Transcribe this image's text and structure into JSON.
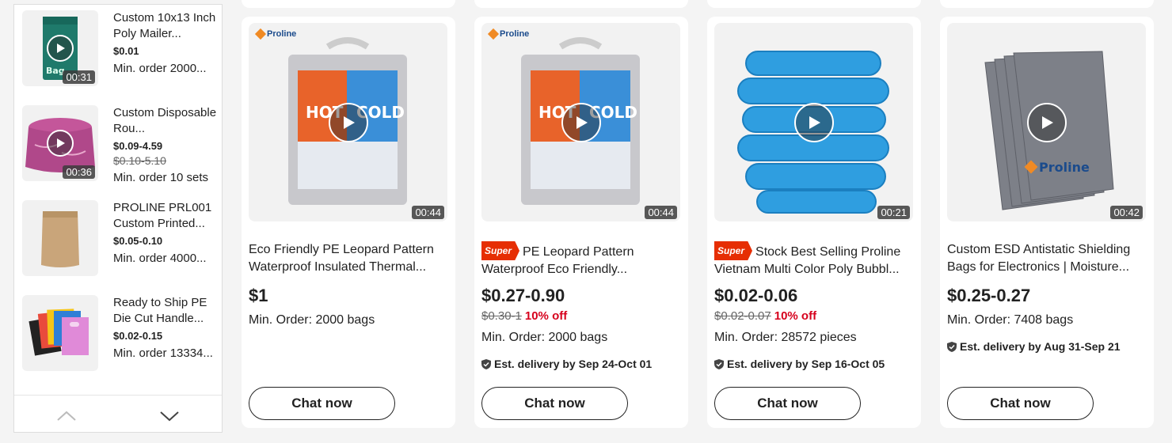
{
  "sidebar": {
    "items": [
      {
        "title": "Custom 10x13 Inch Poly Mailer...",
        "price": "$0.01",
        "old_price": "",
        "moq": "Min. order 2000...",
        "duration": "00:31",
        "thumb_icon": "poly-mailer-bag",
        "thumb_color": "#1f7a6b"
      },
      {
        "title": "Custom Disposable Rou...",
        "price": "$0.09-4.59",
        "old_price": "$0.10-5.10",
        "moq": "Min. order 10 sets",
        "duration": "00:36",
        "thumb_icon": "tablecloth",
        "thumb_color": "#b0488a"
      },
      {
        "title": "PROLINE PRL001 Custom Printed...",
        "price": "$0.05-0.10",
        "old_price": "",
        "moq": "Min. order 4000...",
        "duration": "",
        "thumb_icon": "kraft-pouch",
        "thumb_color": "#c9a57a"
      },
      {
        "title": "Ready to Ship PE Die Cut Handle...",
        "price": "$0.02-0.15",
        "old_price": "",
        "moq": "Min. order 13334...",
        "duration": "",
        "thumb_icon": "colorful-bags",
        "thumb_color": "#2f7fd6"
      }
    ],
    "nav_up_icon": "chevron-up-icon",
    "nav_down_icon": "chevron-down-icon"
  },
  "logo_text": "Proline",
  "products": [
    {
      "super": "",
      "title": "Eco Friendly PE Leopard Pattern Waterproof Insulated Thermal...",
      "price": "$1",
      "old_price": "",
      "discount": "",
      "moq": "Min. Order: 2000 bags",
      "delivery": "",
      "duration": "00:44",
      "chat": "Chat now",
      "image": "insulated-bag"
    },
    {
      "super": "Super",
      "title": "PE Leopard Pattern Waterproof Eco Friendly...",
      "price": "$0.27-0.90",
      "old_price": "$0.30-1",
      "discount": "10% off",
      "moq": "Min. Order: 2000 bags",
      "delivery": "Est. delivery by Sep 24-Oct 01",
      "duration": "00:44",
      "chat": "Chat now",
      "image": "insulated-bag"
    },
    {
      "super": "Super",
      "title": "Stock Best Selling Proline Vietnam Multi Color Poly Bubbl...",
      "price": "$0.02-0.06",
      "old_price": "$0.02-0.07",
      "discount": "10% off",
      "moq": "Min. Order: 28572 pieces",
      "delivery": "Est. delivery by Sep 16-Oct 05",
      "duration": "00:21",
      "chat": "Chat now",
      "image": "blue-rolls"
    },
    {
      "super": "",
      "title": "Custom ESD Antistatic Shielding Bags for Electronics | Moisture...",
      "price": "$0.25-0.27",
      "old_price": "",
      "discount": "",
      "moq": "Min. Order: 7408 bags",
      "delivery": "Est. delivery by Aug 31-Sep 21",
      "duration": "00:42",
      "chat": "Chat now",
      "image": "esd-bags"
    }
  ]
}
